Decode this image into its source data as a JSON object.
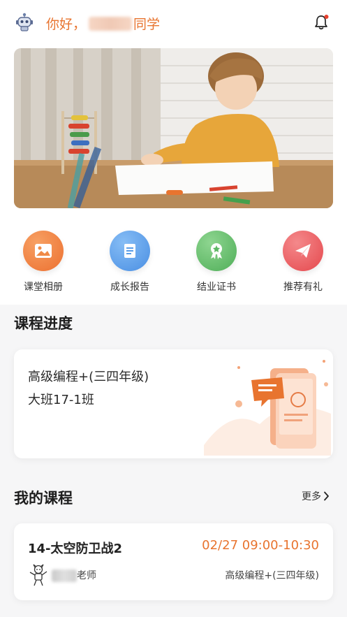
{
  "header": {
    "greeting_prefix": "你好，",
    "greeting_suffix": "同学"
  },
  "quick_actions": [
    {
      "label": "课堂相册",
      "icon": "photo-album-icon",
      "color": "#f0803a"
    },
    {
      "label": "成长报告",
      "icon": "report-icon",
      "color": "#5aa0ea"
    },
    {
      "label": "结业证书",
      "icon": "certificate-icon",
      "color": "#63bf6b"
    },
    {
      "label": "推荐有礼",
      "icon": "paper-plane-icon",
      "color": "#ea5d61"
    }
  ],
  "progress": {
    "title": "课程进度",
    "course_name": "高级编程+(三四年级)",
    "class_name": "大班17-1班"
  },
  "my_courses": {
    "title": "我的课程",
    "more_label": "更多",
    "lessons": [
      {
        "title": "14-太空防卫战2",
        "time": "02/27 09:00-10:30",
        "teacher_suffix": "老师",
        "course": "高级编程+(三四年级)"
      }
    ]
  },
  "colors": {
    "accent": "#e8742f",
    "background": "#f6f6f7"
  }
}
